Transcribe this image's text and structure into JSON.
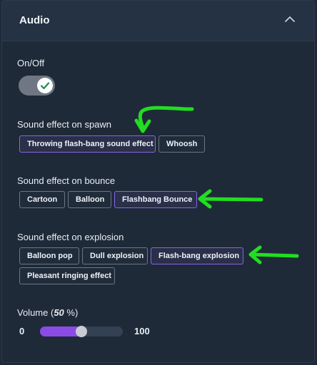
{
  "header": {
    "title": "Audio"
  },
  "onoff": {
    "label": "On/Off",
    "enabled": true
  },
  "spawn": {
    "label": "Sound effect on spawn",
    "options": [
      "Throwing flash-bang sound effect",
      "Whoosh"
    ],
    "selected": "Throwing flash-bang sound effect"
  },
  "bounce": {
    "label": "Sound effect on bounce",
    "options": [
      "Cartoon",
      "Balloon",
      "Flashbang Bounce"
    ],
    "selected": "Flashbang Bounce"
  },
  "explosion": {
    "label": "Sound effect on explosion",
    "options": [
      "Balloon pop",
      "Dull explosion",
      "Flash-bang explosion",
      "Pleasant ringing effect"
    ],
    "selected": "Flash-bang explosion"
  },
  "volume": {
    "label_prefix": "Volume (",
    "value_text": "50",
    "label_suffix": " %)",
    "min": "0",
    "max": "100",
    "value": 50
  },
  "colors": {
    "accent": "#8b4be6",
    "annotation_arrow": "#22dd22",
    "panel_bg": "#1f2a38"
  },
  "icons": {
    "collapse": "chevron-up-icon",
    "toggle_check": "check-icon",
    "annotation": "green-arrow-annotation"
  }
}
